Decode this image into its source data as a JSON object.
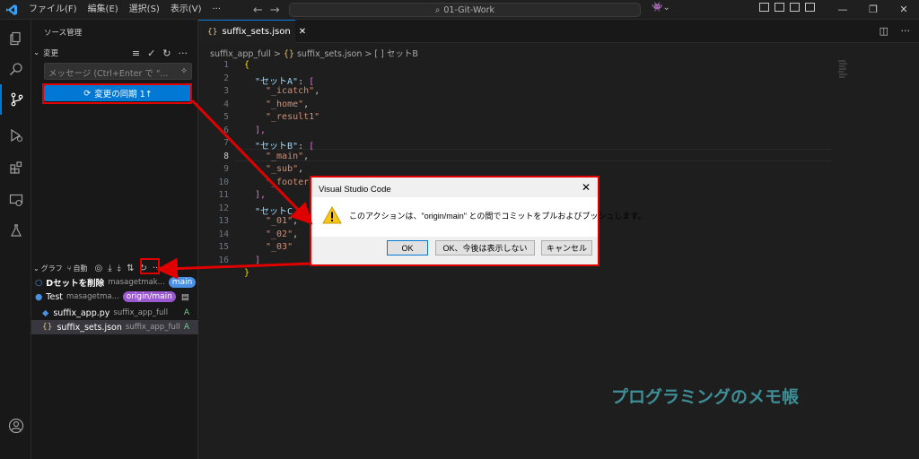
{
  "menu": [
    "ファイル(F)",
    "編集(E)",
    "選択(S)",
    "表示(V)",
    "···"
  ],
  "search": {
    "label": "01-Git-Work"
  },
  "sidebar": {
    "title": "ソース管理",
    "changes_label": "変更",
    "message_placeholder": "メッセージ (Ctrl+Enter で \"...",
    "sync_button": "変更の同期 1↑",
    "graph": {
      "label": "グラフ",
      "auto_label": "自動",
      "commits": [
        {
          "title": "Dセットを削除",
          "author": "masagetmak...",
          "badge": "main"
        },
        {
          "title": "Test",
          "author": "masagetma...",
          "badge": "origin/main"
        }
      ],
      "files": [
        {
          "name": "suffix_app.py",
          "path": "suffix_app_full",
          "status": "A"
        },
        {
          "name": "suffix_sets.json",
          "path": "suffix_app_full",
          "status": "A"
        }
      ]
    }
  },
  "editor": {
    "tab_label": "suffix_sets.json",
    "breadcrumb": {
      "folder": "suffix_app_full",
      "file": "suffix_sets.json",
      "symbol": "セットB"
    },
    "line_numbers": [
      "1",
      "2",
      "3",
      "4",
      "5",
      "6",
      "7",
      "8",
      "9",
      "10",
      "11",
      "12",
      "13",
      "14",
      "15",
      "16"
    ],
    "lines": {
      "l1": "{",
      "l2_key": "\"セットA\"",
      "l3": "\"_icatch\"",
      "l4": "\"_home\"",
      "l5": "\"_result1\"",
      "l6": "],",
      "l7_key": "\"セットB\"",
      "l8": "\"_main\"",
      "l9": "\"_sub\"",
      "l10": "\"_footer",
      "l11": "],",
      "l12_key": "\"セットC",
      "l13": "\"_01\"",
      "l14": "\"_02\"",
      "l15": "\"_03\"",
      "l16": "]",
      "l17": "}"
    }
  },
  "dialog": {
    "title": "Visual Studio Code",
    "message": "このアクションは、\"origin/main\" との間でコミットをプルおよびプッシュします。",
    "ok": "OK",
    "ok_dont_show": "OK、今後は表示しない",
    "cancel": "キャンセル"
  },
  "watermark": "プログラミングのメモ帳",
  "colors": {
    "accent": "#0078d4",
    "highlight": "#e00000",
    "main_badge": "#4a90e2",
    "origin_badge": "#9b59d0"
  }
}
